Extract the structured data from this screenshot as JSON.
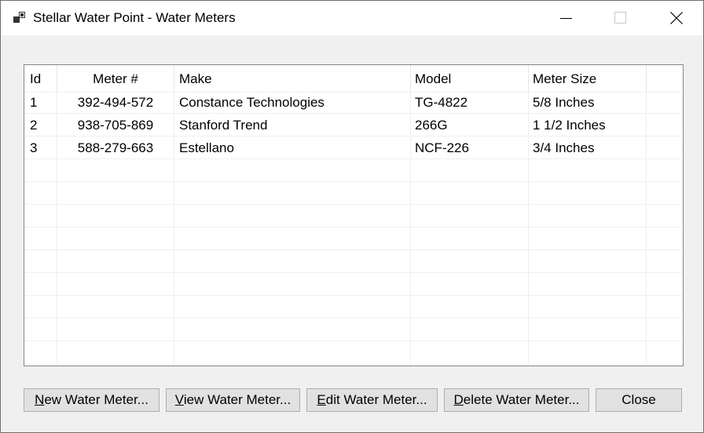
{
  "window": {
    "title": "Stellar Water Point - Water Meters",
    "app_icon": "app-window-icon",
    "controls": [
      "minimize-icon",
      "maximize-icon",
      "close-icon"
    ]
  },
  "table": {
    "columns": [
      "Id",
      "Meter #",
      "Make",
      "Model",
      "Meter Size"
    ],
    "rows": [
      {
        "id": "1",
        "meter": "392-494-572",
        "make": "Constance Technologies",
        "model": "TG-4822",
        "size": "5/8 Inches"
      },
      {
        "id": "2",
        "meter": "938-705-869",
        "make": "Stanford Trend",
        "model": "266G",
        "size": "1 1/2 Inches"
      },
      {
        "id": "3",
        "meter": "588-279-663",
        "make": "Estellano",
        "model": "NCF-226",
        "size": "3/4 Inches"
      }
    ]
  },
  "buttons": {
    "new": {
      "mnemonic": "N",
      "rest": "ew Water Meter..."
    },
    "view": {
      "mnemonic": "V",
      "rest": "iew Water Meter..."
    },
    "edit": {
      "mnemonic": "E",
      "rest": "dit Water Meter..."
    },
    "delete": {
      "mnemonic": "D",
      "rest": "elete Water Meter..."
    },
    "close": {
      "label": "Close"
    }
  }
}
